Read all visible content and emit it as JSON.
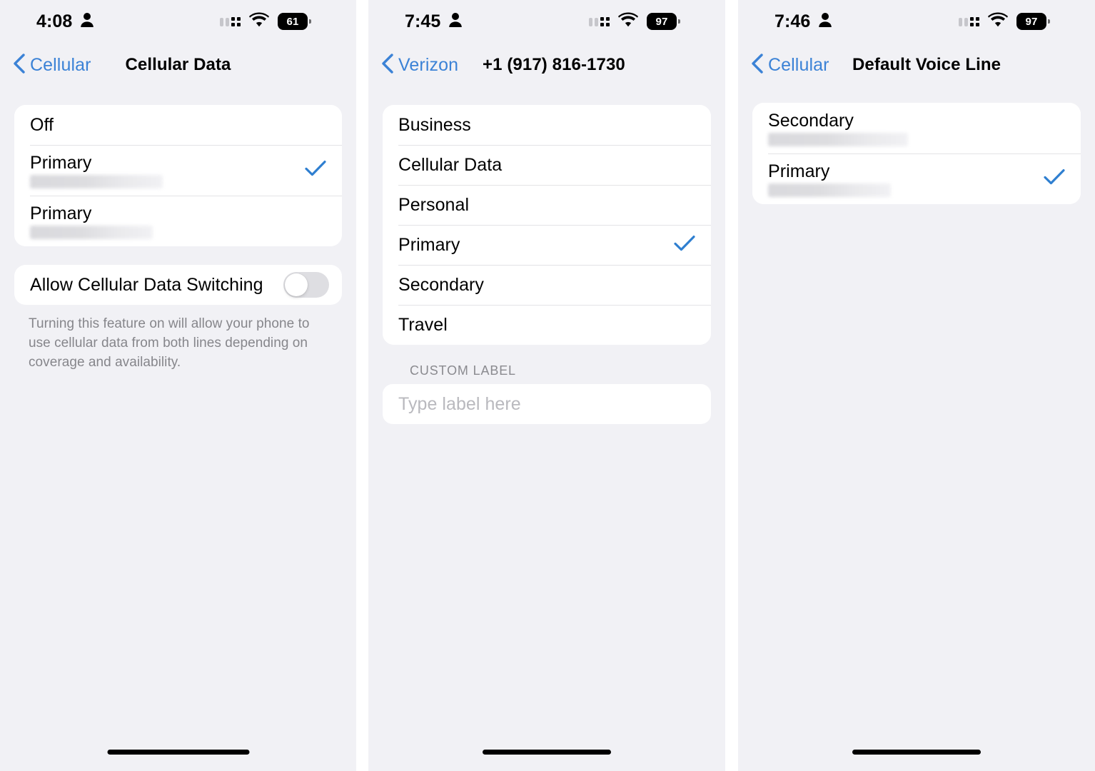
{
  "panels": [
    {
      "status": {
        "time": "4:08",
        "battery": "61",
        "person_icon": "person-icon",
        "cellular_icon": "cellular-signal-icon",
        "wifi_icon": "wifi-icon"
      },
      "nav": {
        "back_label": "Cellular",
        "title": "Cellular Data"
      },
      "list": {
        "rows": [
          {
            "title": "Off",
            "subtitle_redacted": false,
            "checked": false
          },
          {
            "title": "Primary",
            "subtitle_redacted": true,
            "checked": true
          },
          {
            "title": "Primary",
            "subtitle_redacted": true,
            "checked": false
          }
        ]
      },
      "toggle": {
        "label": "Allow Cellular Data Switching",
        "on": false
      },
      "footnote": "Turning this feature on will allow your phone to use cellular data from both lines depending on coverage and availability."
    },
    {
      "status": {
        "time": "7:45",
        "battery": "97",
        "person_icon": "person-icon",
        "cellular_icon": "cellular-signal-icon",
        "wifi_icon": "wifi-icon"
      },
      "nav": {
        "back_label": "Verizon",
        "title": "+1 (917) 816-1730"
      },
      "list": {
        "rows": [
          {
            "title": "Business",
            "checked": false
          },
          {
            "title": "Cellular Data",
            "checked": false
          },
          {
            "title": "Personal",
            "checked": false
          },
          {
            "title": "Primary",
            "checked": true
          },
          {
            "title": "Secondary",
            "checked": false
          },
          {
            "title": "Travel",
            "checked": false
          }
        ]
      },
      "custom_label": {
        "header": "CUSTOM LABEL",
        "value": "",
        "placeholder": "Type label here"
      }
    },
    {
      "status": {
        "time": "7:46",
        "battery": "97",
        "person_icon": "person-icon",
        "cellular_icon": "cellular-signal-icon",
        "wifi_icon": "wifi-icon"
      },
      "nav": {
        "back_label": "Cellular",
        "title": "Default Voice Line"
      },
      "list": {
        "rows": [
          {
            "title": "Secondary",
            "subtitle_redacted": true,
            "checked": false
          },
          {
            "title": "Primary",
            "subtitle_redacted": true,
            "checked": true
          }
        ]
      }
    }
  ],
  "colors": {
    "accent_blue": "#3b82d6",
    "checkmark_blue": "#2f7fd0",
    "page_background": "#f1f1f5",
    "card_background": "#ffffff",
    "separator": "#e3e3e6",
    "secondary_text": "#86868b",
    "placeholder_text": "#b9b9be",
    "switch_off": "#dedee2"
  }
}
